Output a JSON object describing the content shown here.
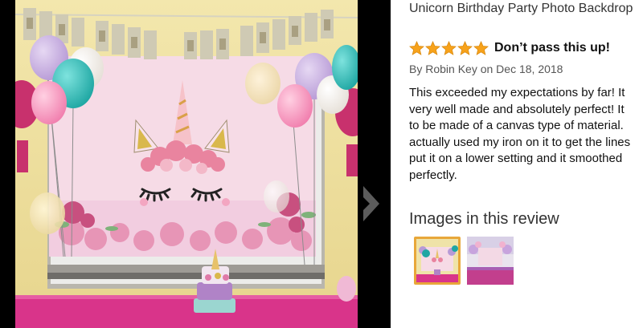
{
  "review": {
    "product_title": "Unicorn Birthday Party Photo Backdrop",
    "rating": 5,
    "rating_max": 5,
    "headline": "Don’t pass this up!",
    "byline_prefix": "By ",
    "author": "Robin Key",
    "date": " on Dec 18, 2018",
    "body_lines": [
      "This exceeded my expectations by far! It",
      "very well made and absolutely perfect! It",
      "to be made of a canvas type of material.",
      "actually used my iron on it to get the lines",
      "put it on a lower setting and it smoothed",
      "perfectly."
    ]
  },
  "images_section": {
    "title": "Images in this review",
    "selected_index": 0
  },
  "colors": {
    "star": "#f7a21b",
    "selected_border": "#e8a73a",
    "tablecloth": "#d9348a",
    "backdrop": "#f6dbe6"
  },
  "icons": {
    "next": "chevron-right-icon",
    "rating": "star-icon"
  }
}
